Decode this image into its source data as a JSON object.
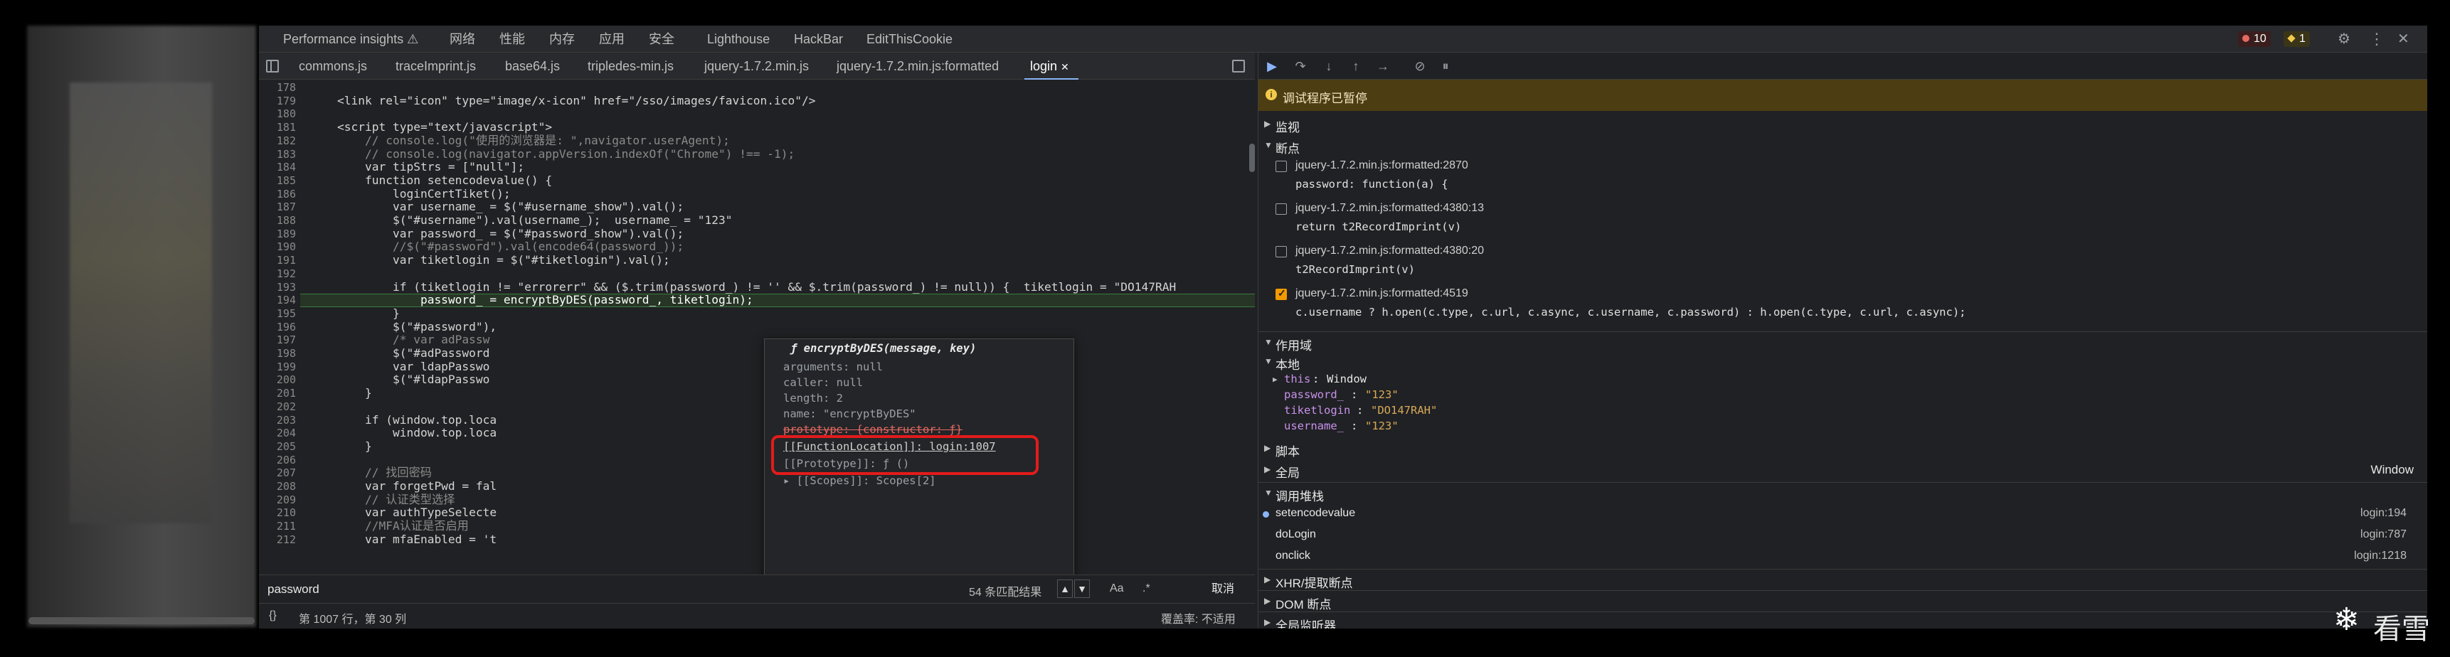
{
  "topbar": {
    "tabs": [
      "Performance insights ⚠",
      "网络",
      "性能",
      "内存",
      "应用",
      "安全",
      "Lighthouse",
      "HackBar",
      "EditThisCookie"
    ],
    "errors": "10",
    "warnings": "1"
  },
  "filetabs": [
    "commons.js",
    "traceImprint.js",
    "base64.js",
    "tripledes-min.js",
    "jquery-1.7.2.min.js",
    "jquery-1.7.2.min.js:formatted",
    "login"
  ],
  "code": {
    "line_numbers": [
      "178",
      "179",
      "180",
      "181",
      "182",
      "183",
      "184",
      "185",
      "186",
      "187",
      "188",
      "189",
      "190",
      "191",
      "192",
      "193",
      "194",
      "195",
      "196",
      "197",
      "198",
      "199",
      "200",
      "201",
      "202",
      "203",
      "204",
      "205",
      "206",
      "207",
      "208",
      "209",
      "210",
      "211",
      "212"
    ],
    "lines": [
      "",
      "<link rel=\"icon\" type=\"image/x-icon\" href=\"/sso/images/favicon.ico\"/>",
      "",
      "<script type=\"text/javascript\">",
      "    // console.log(\"使用的浏览器是: \",navigator.userAgent);",
      "    // console.log(navigator.appVersion.indexOf(\"Chrome\") !== -1);",
      "    var tipStrs = [\"null\"];",
      "    function setencodevalue() {",
      "        loginCertTiket();",
      "        var username_ = $(\"#username_show\").val();",
      "        $(\"#username\").val(username_);  username_ = \"123\"",
      "        var password_ = $(\"#password_show\").val();",
      "        //$(\"#password\").val(encode64(password_));",
      "        var tiketlogin = $(\"#tiketlogin\").val();",
      "",
      "        if (tiketlogin != \"errorerr\" && ($.trim(password_) != '' && $.trim(password_) != null)) {  tiketlogin = \"DO147RAH",
      "            password_ = encryptByDES(password_, tiketlogin);",
      "        }",
      "        $(\"#password\"),",
      "        /* var adPassw",
      "        $(\"#adPassword",
      "        var ldapPasswo",
      "        $(\"#ldapPasswo",
      "    }",
      "",
      "    if (window.top.loca",
      "        window.top.loca",
      "    }",
      "",
      "    // 找回密码",
      "    var forgetPwd = fal",
      "    // 认证类型选择",
      "    var authTypeSelecte",
      "    //MFA认证是否启用",
      "    var mfaEnabled = 't"
    ]
  },
  "popup": {
    "title": "ƒ encryptByDES(message, key)",
    "rows": [
      "arguments: null",
      "caller: null",
      "length: 2",
      "name: \"encryptByDES\"",
      "prototype: {constructor: ƒ}",
      "[[FunctionLocation]]: login:1007",
      "[[Prototype]]: ƒ ()",
      "▸ [[Scopes]]: Scopes[2]"
    ]
  },
  "search": {
    "value": "password",
    "matches": "54 条匹配结果",
    "case_label": "Aa",
    "regex_label": ".*",
    "cancel": "取消"
  },
  "status": {
    "braces": "{}",
    "position": "第 1007 行，第 30 列",
    "coverage": "覆盖率: 不适用"
  },
  "debugger": {
    "paused": "调试程序已暂停",
    "sections": {
      "watch": "监视",
      "breakpoints": "断点",
      "scope": "作用域",
      "local": "本地",
      "script": "脚本",
      "global": "全局",
      "global_value": "Window",
      "callstack": "调用堆栈",
      "xhr": "XHR/提取断点",
      "dom": "DOM 断点",
      "listeners": "全局监听器"
    },
    "breakpoints": [
      {
        "name": "jquery-1.7.2.min.js:formatted:2870",
        "code": "password: function(a) {",
        "checked": false
      },
      {
        "name": "jquery-1.7.2.min.js:formatted:4380:13",
        "code": "return t2RecordImprint(v)",
        "checked": false
      },
      {
        "name": "jquery-1.7.2.min.js:formatted:4380:20",
        "code": "t2RecordImprint(v)",
        "checked": false
      },
      {
        "name": "jquery-1.7.2.min.js:formatted:4519",
        "code": "c.username ? h.open(c.type, c.url, c.async, c.username, c.password) : h.open(c.type, c.url, c.async);",
        "checked": true
      }
    ],
    "scope": [
      {
        "key": "this",
        "value": "Window"
      },
      {
        "key": "password_",
        "value": "\"123\""
      },
      {
        "key": "tiketlogin",
        "value": "\"DO147RAH\""
      },
      {
        "key": "username_",
        "value": "\"123\""
      }
    ],
    "callstack": [
      {
        "fn": "setencodevalue",
        "loc": "login:194"
      },
      {
        "fn": "doLogin",
        "loc": "login:787"
      },
      {
        "fn": "onclick",
        "loc": "login:1218"
      }
    ]
  },
  "watermark": "看雪"
}
